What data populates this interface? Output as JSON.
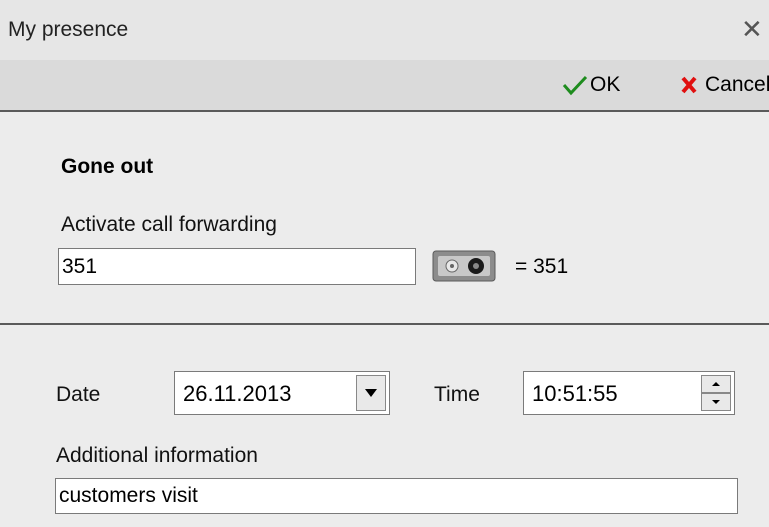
{
  "window": {
    "title": "My presence",
    "close_icon": "close-icon"
  },
  "toolbar": {
    "ok_label": "OK",
    "cancel_label": "Cancel",
    "ok_color": "#1e8c1e",
    "cancel_color": "#e01010"
  },
  "status": {
    "title": "Gone out"
  },
  "forwarding": {
    "label": "Activate call forwarding",
    "value": "351",
    "resolved": "= 351",
    "icon": "cassette-icon"
  },
  "schedule": {
    "date_label": "Date",
    "date_value": "26.11.2013",
    "time_label": "Time",
    "time_value": "10:51:55"
  },
  "info": {
    "label": "Additional information",
    "value": "customers visit"
  }
}
